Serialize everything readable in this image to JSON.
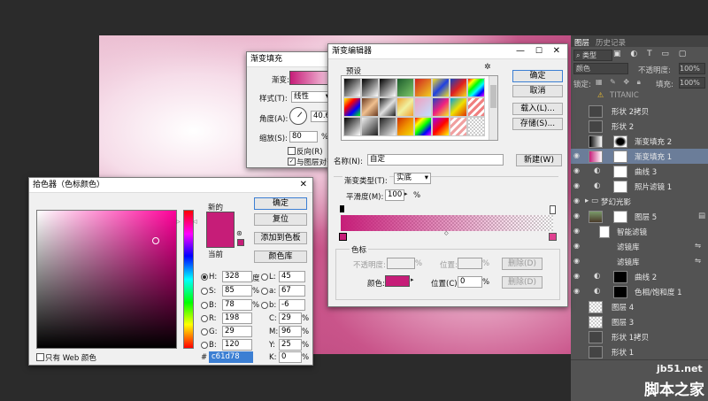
{
  "app_bg": "#2b2b2b",
  "gradient_fill": {
    "title": "渐变填充",
    "gradient_label": "渐变:",
    "style_label": "样式(T):",
    "style_value": "线性",
    "angle_label": "角度(A):",
    "angle_value": "40.6",
    "scale_label": "缩放(S):",
    "scale_value": "80",
    "scale_unit": "%",
    "reverse_label": "反向(R)",
    "align_label": "与图层对齐"
  },
  "gradient_editor": {
    "title": "渐变编辑器",
    "presets_label": "预设",
    "ok": "确定",
    "cancel": "取消",
    "load": "载入(L)...",
    "save": "存储(S)...",
    "name_label": "名称(N):",
    "name_value": "自定",
    "new_button": "新建(W)",
    "type_label": "渐变类型(T):",
    "type_value": "实底",
    "smooth_label": "平滑度(M):",
    "smooth_value": "100",
    "smooth_unit": "%",
    "stops_label": "色标",
    "opacity_label": "不透明度:",
    "opacity_unit": "%",
    "location_label": "位置:",
    "location_unit": "%",
    "delete_button": "删除(D)",
    "color_label": "颜色:",
    "color_location_label": "位置(C):",
    "color_location_value": "0",
    "color_location_unit": "%",
    "delete_button2": "删除(D)",
    "stop_color": "#c61d78"
  },
  "color_picker": {
    "title": "拾色器（色标颜色）",
    "new_label": "新的",
    "current_label": "当前",
    "ok": "确定",
    "reset": "复位",
    "add_swatch": "添加到色板",
    "color_libraries": "颜色库",
    "only_web": "只有 Web 颜色",
    "hex_prefix": "#",
    "hex_value": "c61d78",
    "fields": {
      "H": {
        "label": "H:",
        "value": "328",
        "unit": "度"
      },
      "S": {
        "label": "S:",
        "value": "85",
        "unit": "%"
      },
      "Bv": {
        "label": "B:",
        "value": "78",
        "unit": "%"
      },
      "R": {
        "label": "R:",
        "value": "198"
      },
      "G": {
        "label": "G:",
        "value": "29"
      },
      "B": {
        "label": "B:",
        "value": "120"
      },
      "L": {
        "label": "L:",
        "value": "45"
      },
      "a": {
        "label": "a:",
        "value": "67"
      },
      "b": {
        "label": "b:",
        "value": "-6"
      },
      "C": {
        "label": "C:",
        "value": "29",
        "unit": "%"
      },
      "M": {
        "label": "M:",
        "value": "96",
        "unit": "%"
      },
      "Y": {
        "label": "Y:",
        "value": "25",
        "unit": "%"
      },
      "K": {
        "label": "K:",
        "value": "0",
        "unit": "%"
      }
    },
    "new_color": "#c61d78",
    "current_color": "#c61d78"
  },
  "layers_panel": {
    "tab_layers": "图层",
    "tab_history": "历史记录",
    "kind_label": "类型",
    "blend_mode": "颜色",
    "opacity_label": "不透明度:",
    "opacity_value": "100%",
    "lock_label": "锁定:",
    "fill_label": "填充:",
    "fill_value": "100%",
    "layers": [
      {
        "name": "TITANIC"
      },
      {
        "name": "形状 2拷贝"
      },
      {
        "name": "形状 2"
      },
      {
        "name": "渐变填充 2"
      },
      {
        "name": "渐变填充 1"
      },
      {
        "name": "曲线 3"
      },
      {
        "name": "照片滤镜 1"
      },
      {
        "name": "梦幻光影"
      },
      {
        "name": "图层 5"
      },
      {
        "name": "智能滤镜"
      },
      {
        "name": "滤镜库"
      },
      {
        "name": "滤镜库"
      },
      {
        "name": "曲线 2"
      },
      {
        "name": "色相/饱和度 1"
      },
      {
        "name": "图层 4"
      },
      {
        "name": "图层 3"
      },
      {
        "name": "形状 1拷贝"
      },
      {
        "name": "形状 1"
      }
    ]
  },
  "watermark": {
    "site": "jb51.net",
    "name": "脚本之家"
  }
}
